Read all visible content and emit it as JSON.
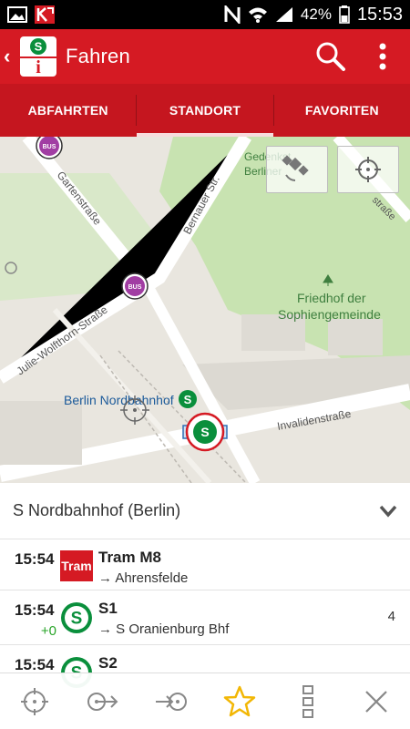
{
  "status_bar": {
    "battery": "42%",
    "time": "15:53"
  },
  "app_bar": {
    "title": "Fahren",
    "logo_top": "S",
    "logo_bottom": "i"
  },
  "tabs": [
    {
      "label": "ABFAHRTEN",
      "active": false
    },
    {
      "label": "STANDORT",
      "active": true
    },
    {
      "label": "FAVORITEN",
      "active": false
    }
  ],
  "map": {
    "streets": {
      "gartenstrasse": "Gartenstraße",
      "bernauer": "Bernauer Str.",
      "julie": "Julie-Wolfthorn-Straße",
      "invaliden": "Invalidenstraße",
      "partial_strasse": "straße"
    },
    "places": {
      "gedenk_line1": "Gedenkst",
      "gedenk_line2": "Berliner",
      "friedhof_line1": "Friedhof der",
      "friedhof_line2": "Sophiengemeinde",
      "station": "Berlin Nordbahnhof"
    },
    "bus_label": "BUS",
    "s_label": "S",
    "colors": {
      "green": "#c8e3b1",
      "road": "#ffffff",
      "bus": "#a13da3",
      "sbahn": "#0a8f3c",
      "accent": "#d51a23"
    }
  },
  "sheet": {
    "station": "S Nordbahnhof (Berlin)",
    "departures": [
      {
        "time": "15:54",
        "delay": "",
        "type": "tram",
        "badge": "Tram",
        "line": "Tram M8",
        "dest": "→ Ahrensfelde",
        "platform": ""
      },
      {
        "time": "15:54",
        "delay": "+0",
        "type": "sbahn",
        "badge": "S",
        "line": "S1",
        "dest": "→ S Oranienburg Bhf",
        "platform": "4"
      },
      {
        "time": "15:54",
        "delay": "",
        "type": "sbahn",
        "badge": "S",
        "line": "S2",
        "dest": "",
        "platform": ""
      }
    ]
  },
  "toolbar": {
    "icons": [
      "crosshair-icon",
      "depart-from-icon",
      "arrive-at-icon",
      "favorite-star-icon",
      "more-options-icon",
      "close-icon"
    ]
  }
}
